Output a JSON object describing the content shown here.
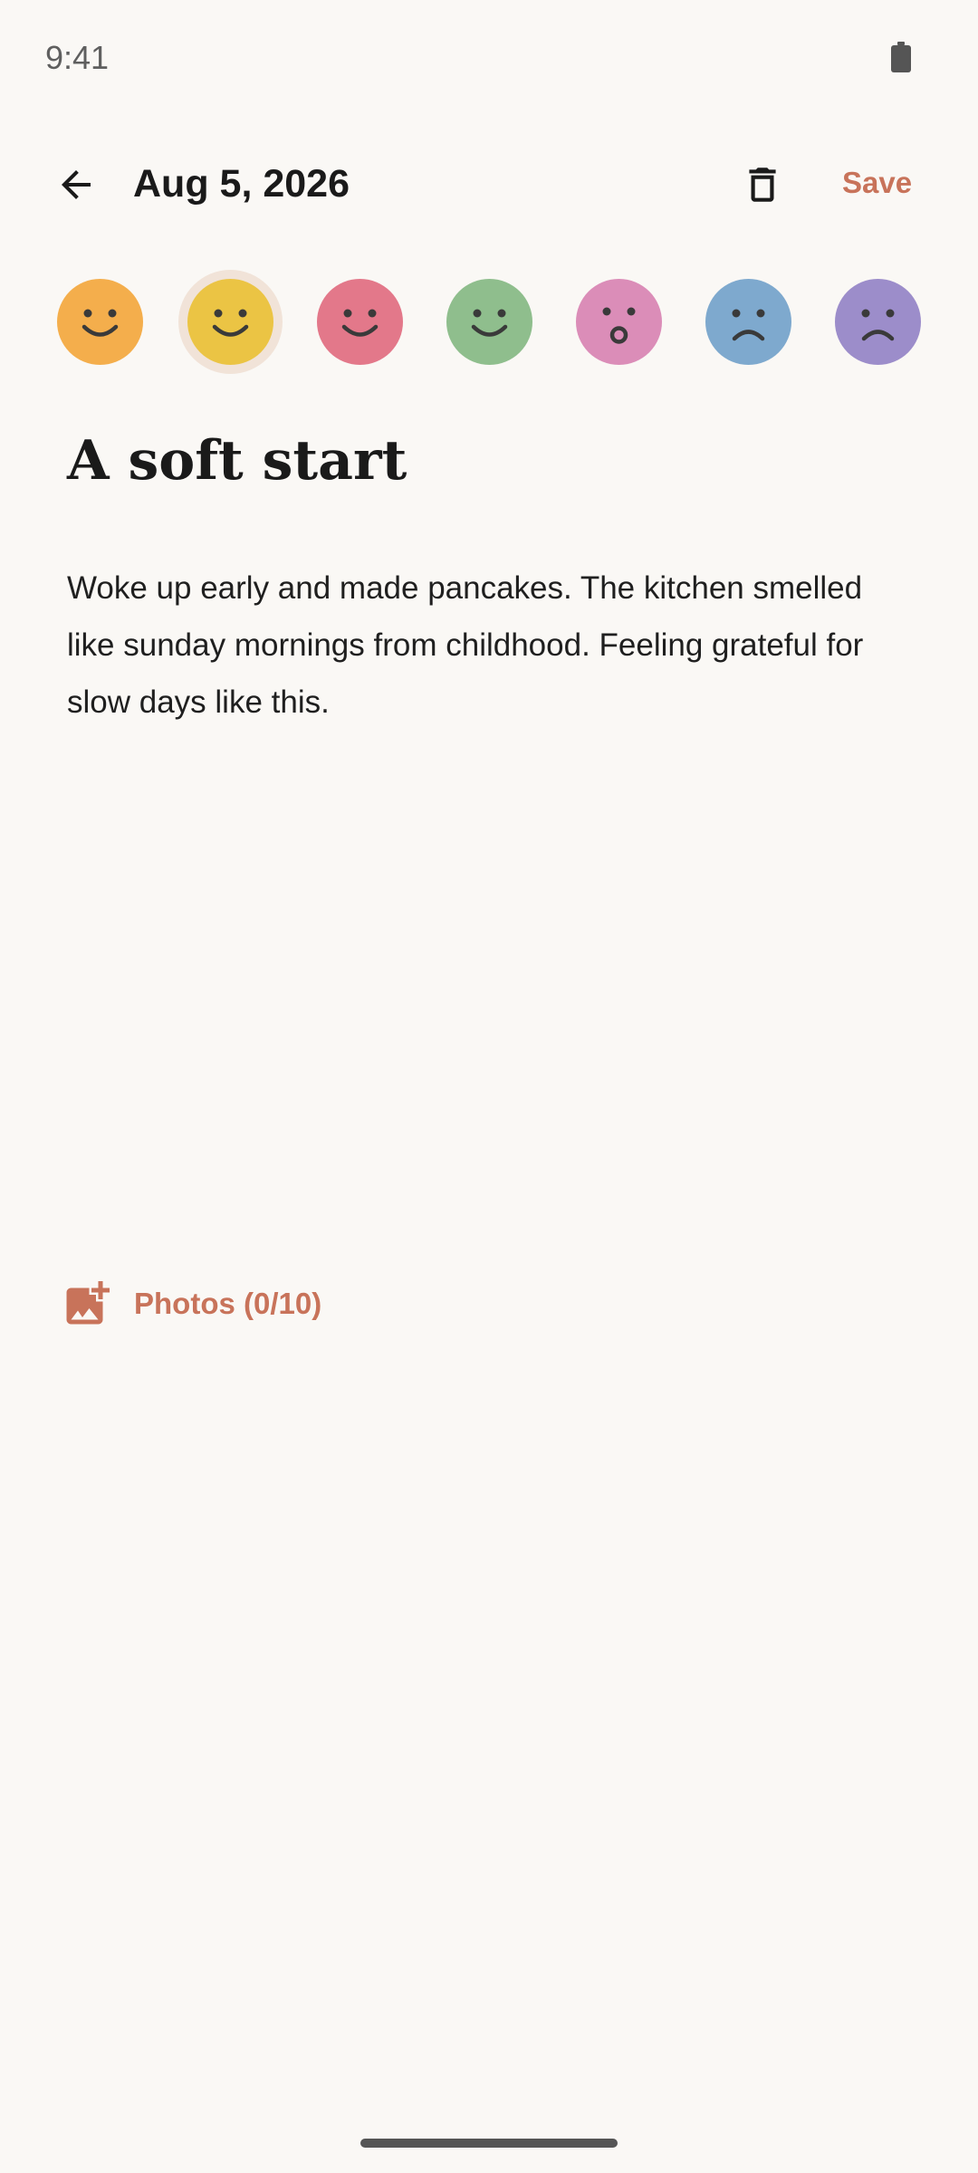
{
  "status_bar": {
    "time": "9:41",
    "battery_icon": "battery-full-icon"
  },
  "app_bar": {
    "back_icon": "arrow-back-icon",
    "date": "Aug 5, 2026",
    "delete_icon": "trash-icon",
    "save_label": "Save"
  },
  "moods": [
    {
      "color": "#F4AE4C",
      "face": "smile",
      "selected": false
    },
    {
      "color": "#EBC444",
      "face": "smile",
      "selected": true
    },
    {
      "color": "#E3788A",
      "face": "smile",
      "selected": false
    },
    {
      "color": "#8FBE8D",
      "face": "smile",
      "selected": false
    },
    {
      "color": "#DB8DB8",
      "face": "surprised",
      "selected": false
    },
    {
      "color": "#7EA9CE",
      "face": "sad",
      "selected": false
    },
    {
      "color": "#9C8DCA",
      "face": "sad",
      "selected": false
    }
  ],
  "entry": {
    "title": "A soft start",
    "body": "Woke up early and made pancakes. The kitchen smelled like sunday mornings from childhood. Feeling grateful for slow days like this."
  },
  "photos": {
    "icon": "add-photo-icon",
    "label": "Photos (0/10)"
  },
  "colors": {
    "accent": "#C8735A",
    "background": "#FAF8F5",
    "selected_ring": "#F1E3D8"
  }
}
